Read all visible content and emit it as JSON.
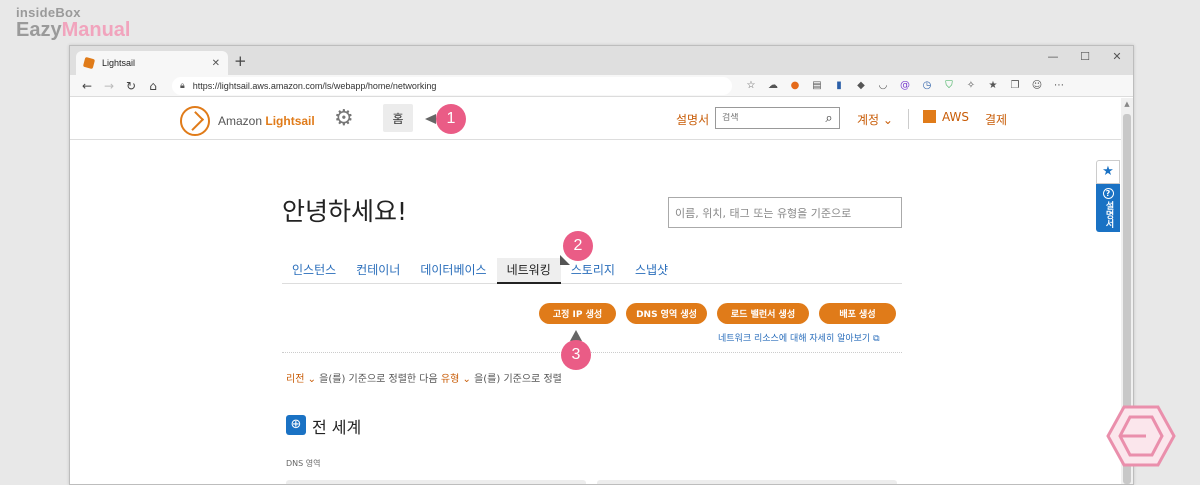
{
  "watermark": {
    "line1": "insideBox",
    "line2a": "Eazy",
    "line2b": "Manual"
  },
  "browser": {
    "tab_title": "Lightsail",
    "new_tab": "+",
    "url": "https://lightsail.aws.amazon.com/ls/webapp/home/networking",
    "win_min": "—",
    "win_max": "☐",
    "win_close": "✕"
  },
  "lightsail_nav": {
    "brand_prefix": "Amazon",
    "brand_name": "Lightsail",
    "home_label": "홈",
    "guide_label": "설명서",
    "search_placeholder": "검색",
    "account_label": "계정",
    "aws_label": "AWS",
    "billing_label": "결제"
  },
  "page": {
    "greeting": "안녕하세요!",
    "search_placeholder": "이름, 위치, 태그 또는 유형을 기준으로",
    "tabs": [
      "인스턴스",
      "컨테이너",
      "데이터베이스",
      "네트워킹",
      "스토리지",
      "스냅샷"
    ],
    "active_tab": "네트워킹",
    "buttons": {
      "static_ip": "고정 IP 생성",
      "dns_zone": "DNS 영역 생성",
      "load_balancer": "로드 밸런서 생성",
      "distribution": "배포 생성"
    },
    "learn_more": "네트워크 리소스에 대해 자세히 알아보기",
    "sort": {
      "field1": "리전",
      "mid": "을(를) 기준으로 정렬한 다음",
      "field2": "유형",
      "tail": "을(를) 기준으로 정렬"
    },
    "region_heading": "전 세계",
    "dns_label": "DNS 영역"
  },
  "side_tab": {
    "help_label": "설명서"
  },
  "markers": [
    "1",
    "2",
    "3"
  ],
  "colors": {
    "accent_orange": "#e07b19",
    "link_blue": "#2a6ebb",
    "marker_pink": "#ea5c86"
  }
}
